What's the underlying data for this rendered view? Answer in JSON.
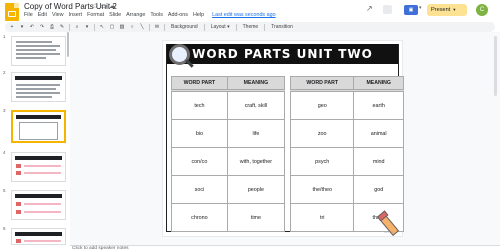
{
  "app": {
    "title": "Copy of Word Parts Unit 2",
    "menu": [
      "File",
      "Edit",
      "View",
      "Insert",
      "Format",
      "Slide",
      "Arrange",
      "Tools",
      "Add-ons",
      "Help"
    ],
    "last_edit": "Last edit was seconds ago",
    "present_label": "Present",
    "user_initial": "C"
  },
  "toolbar": {
    "background_label": "Background",
    "layout_label": "Layout ▾",
    "theme_label": "Theme",
    "transition_label": "Transition"
  },
  "filmstrip": {
    "slides": [
      {
        "num": "1"
      },
      {
        "num": "2"
      },
      {
        "num": "3"
      },
      {
        "num": "4"
      },
      {
        "num": "5"
      },
      {
        "num": "6"
      }
    ]
  },
  "slide": {
    "banner": "WORD PARTS UNIT TWO",
    "headers": [
      "WORD PART",
      "MEANING"
    ],
    "left_rows": [
      [
        "tech",
        "craft, skill"
      ],
      [
        "bio",
        "life"
      ],
      [
        "con/co",
        "with, together"
      ],
      [
        "soci",
        "people"
      ],
      [
        "chrono",
        "time"
      ]
    ],
    "right_rows": [
      [
        "geo",
        "earth"
      ],
      [
        "zoo",
        "animal"
      ],
      [
        "psych",
        "mind"
      ],
      [
        "the/theo",
        "god"
      ],
      [
        "tri",
        "three"
      ]
    ]
  },
  "notes": {
    "placeholder": "Click to add speaker notes"
  },
  "colors": {
    "accent_present": "#fde293",
    "banner_bg": "#111111",
    "selected_thumb": "#f4b400"
  }
}
